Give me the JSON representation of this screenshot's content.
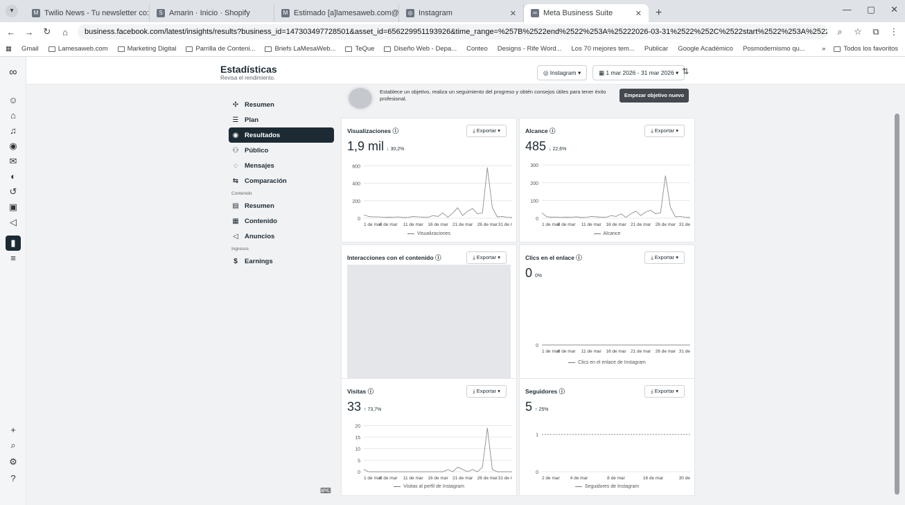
{
  "browser": {
    "tabs": [
      {
        "label": "Twilio News - Tu newsletter co:"
      },
      {
        "label": "Amarin · Inicio · Shopify"
      },
      {
        "label": "Estimado [a]lamesaweb.com@"
      },
      {
        "label": "Instagram"
      },
      {
        "label": "Meta Business Suite"
      }
    ],
    "new_tab": "+",
    "url": "business.facebook.com/latest/insights/results?business_id=147303497728501&asset_id=656229951193926&time_range=%257B%2522end%2522%253A%25222026-03-31%2522%252C%2522start%2522%253A%25222026-03-01%2..."
  },
  "bookmarks": {
    "items": [
      "Gmail",
      "Lamesaweb.com",
      "Marketing Digital",
      "Parrilla de Conteni...",
      "Briefs LaMesaWeb...",
      "TeQue",
      "Diseño Web - Depa...",
      "Conteo",
      "Designs - Rife Word...",
      "Los 70 mejores tem...",
      "Publicar",
      "Google Académico",
      "Posmodernismo qu..."
    ],
    "right": "Todos los favoritos"
  },
  "header": {
    "title": "Estadísticas",
    "subtitle": "Revisa el rendimiento.",
    "account_select": "Instagram",
    "date_select": "1 mar 2026 - 31 mar 2026"
  },
  "nav": {
    "items": [
      {
        "label": "Resumen",
        "icon": "overview-icon"
      },
      {
        "label": "Plan",
        "icon": "list-icon"
      },
      {
        "label": "Resultados",
        "icon": "results-icon"
      },
      {
        "label": "Público",
        "icon": "people-icon"
      },
      {
        "label": "Mensajes",
        "icon": "message-icon"
      },
      {
        "label": "Comparación",
        "icon": "compare-icon"
      }
    ],
    "section_content": "Contenido",
    "content_items": [
      {
        "label": "Resumen",
        "icon": "table-icon"
      },
      {
        "label": "Contenido",
        "icon": "grid-icon"
      },
      {
        "label": "Anuncios",
        "icon": "megaphone-icon"
      }
    ],
    "section_income": "Ingresos",
    "income_items": [
      {
        "label": "Earnings",
        "icon": "dollar-icon"
      }
    ]
  },
  "goal": {
    "text": "Establece un objetivo, realiza un seguimiento del progreso y obtén consejos útiles para tener éxito profesional.",
    "button": "Empezar objetivo nuevo"
  },
  "export_label": "Exportar",
  "cards": {
    "visualizaciones": {
      "title": "Visualizaciones",
      "value": "1,9 mil",
      "change": "↓ 30,2%",
      "legend": "Visualizaciones"
    },
    "alcance": {
      "title": "Alcance",
      "value": "485",
      "change": "↓ 22,6%",
      "legend": "Alcance"
    },
    "interacciones": {
      "title": "Interacciones con el contenido"
    },
    "clics": {
      "title": "Clics en el enlace",
      "value": "0",
      "change": "0%",
      "legend": "Clics en el enlace de Instagram"
    },
    "visitas": {
      "title": "Visitas",
      "value": "33",
      "change": "↑ 73,7%",
      "legend": "Visitas al perfil de Instagram"
    },
    "seguidores": {
      "title": "Seguidores",
      "value": "5",
      "change": "↑ 25%",
      "legend": "Seguidores de Instagram"
    }
  },
  "chart_data": [
    {
      "type": "line",
      "title": "Visualizaciones",
      "x_ticks": [
        "1 de mar",
        "6 de mar",
        "11 de mar",
        "16 de mar",
        "21 de mar",
        "26 de mar",
        "31 de r"
      ],
      "y_ticks": [
        0,
        200,
        400,
        600
      ],
      "ylim": [
        0,
        650
      ],
      "series": [
        {
          "name": "Visualizaciones",
          "values": [
            40,
            20,
            15,
            15,
            10,
            12,
            10,
            15,
            8,
            10,
            20,
            15,
            12,
            10,
            30,
            20,
            60,
            10,
            60,
            120,
            30,
            80,
            110,
            50,
            60,
            580,
            120,
            15,
            20,
            10,
            8
          ]
        }
      ]
    },
    {
      "type": "line",
      "title": "Alcance",
      "x_ticks": [
        "1 de mar",
        "6 de mar",
        "11 de mar",
        "16 de mar",
        "21 de mar",
        "26 de mar",
        "31 de"
      ],
      "y_ticks": [
        0,
        100,
        200,
        300
      ],
      "ylim": [
        0,
        320
      ],
      "series": [
        {
          "name": "Alcance",
          "values": [
            30,
            8,
            6,
            6,
            5,
            6,
            5,
            8,
            4,
            5,
            10,
            8,
            6,
            5,
            15,
            10,
            25,
            5,
            25,
            40,
            15,
            35,
            45,
            25,
            30,
            240,
            60,
            8,
            10,
            5,
            4
          ]
        }
      ]
    },
    {
      "type": "line",
      "title": "Clics en el enlace",
      "x_ticks": [
        "1 de mar",
        "6 de mar",
        "11 de mar",
        "16 de mar",
        "21 de mar",
        "26 de mar",
        "31 de"
      ],
      "y_ticks": [
        0
      ],
      "ylim": [
        0,
        1
      ],
      "series": [
        {
          "name": "Clics en el enlace de Instagram",
          "values": [
            0,
            0,
            0,
            0,
            0,
            0,
            0,
            0,
            0,
            0,
            0,
            0,
            0,
            0,
            0,
            0,
            0,
            0,
            0,
            0,
            0,
            0,
            0,
            0,
            0,
            0,
            0,
            0,
            0,
            0,
            0
          ]
        }
      ]
    },
    {
      "type": "line",
      "title": "Visitas",
      "x_ticks": [
        "1 de mar",
        "6 de mar",
        "11 de mar",
        "16 de mar",
        "21 de mar",
        "26 de mar",
        "31 de r"
      ],
      "y_ticks": [
        0,
        5,
        10,
        15,
        20
      ],
      "ylim": [
        0,
        21
      ],
      "series": [
        {
          "name": "Visitas al perfil de Instagram",
          "values": [
            1,
            0,
            0,
            0,
            0,
            0,
            0,
            0,
            0,
            0,
            0,
            0,
            0,
            0,
            0,
            0,
            0,
            1,
            0,
            2,
            1,
            0,
            1,
            0,
            2,
            19,
            1,
            0,
            0,
            0,
            0
          ]
        }
      ]
    },
    {
      "type": "line",
      "title": "Seguidores",
      "x_ticks": [
        "2 de mar",
        "4 de mar",
        "8 de mar",
        "16 de mar",
        "30 de"
      ],
      "y_ticks": [
        0,
        1
      ],
      "ylim": [
        0,
        1.3
      ],
      "series": [
        {
          "name": "Seguidores de Instagram",
          "values": [
            1,
            1,
            1,
            1,
            1,
            1,
            1,
            1,
            1,
            1,
            1,
            1,
            1,
            1,
            1,
            1,
            1,
            1,
            1,
            1,
            1,
            1,
            1,
            1,
            1,
            1,
            1,
            1,
            1,
            1,
            1
          ]
        }
      ]
    }
  ]
}
